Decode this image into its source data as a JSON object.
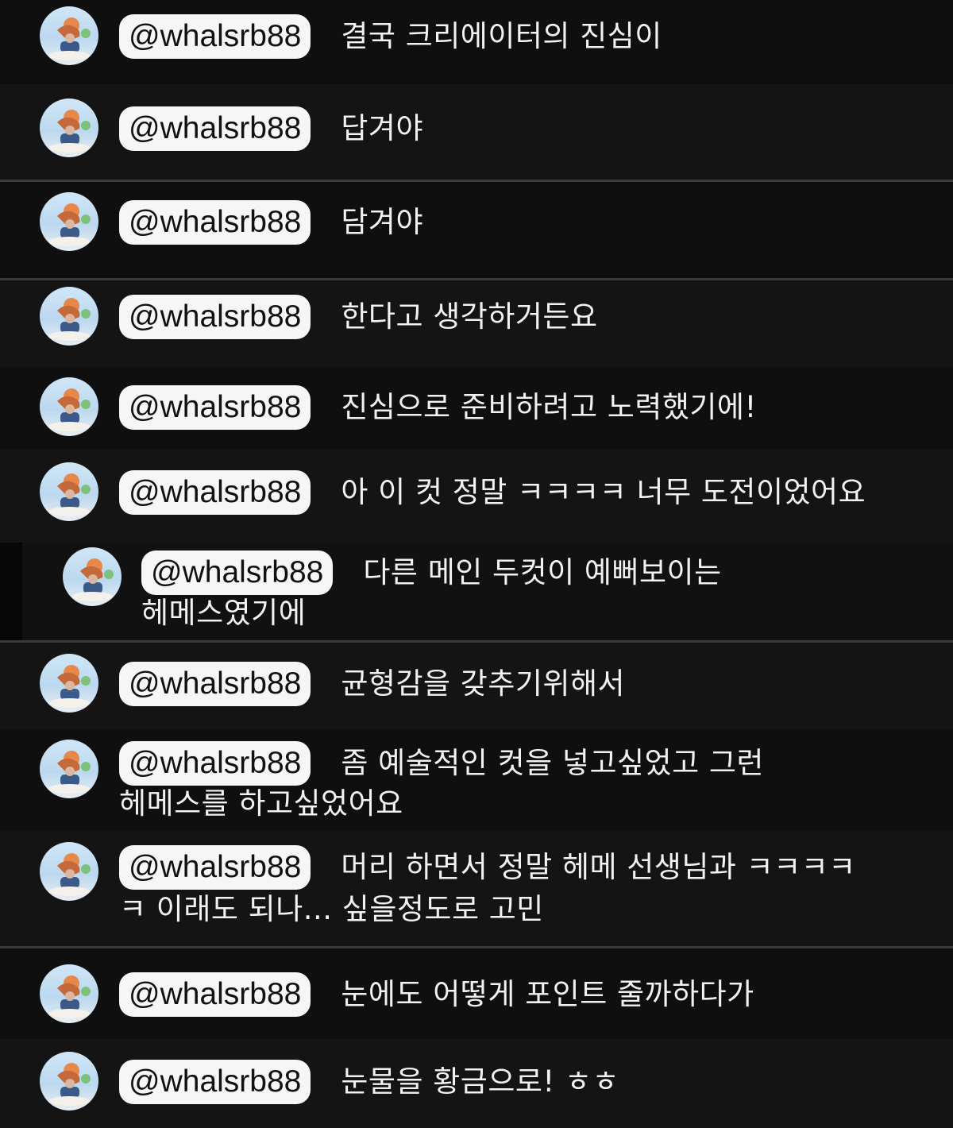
{
  "comments": [
    {
      "username": "@whalsrb88",
      "text": "결국 크리에이터의 진심이"
    },
    {
      "username": "@whalsrb88",
      "text": "답겨야"
    },
    {
      "username": "@whalsrb88",
      "text": "담겨야"
    },
    {
      "username": "@whalsrb88",
      "text": "한다고 생각하거든요"
    },
    {
      "username": "@whalsrb88",
      "text": "진심으로 준비하려고 노력했기에!"
    },
    {
      "username": "@whalsrb88",
      "text": "아 이 컷 정말 ㅋㅋㅋㅋ 너무 도전이었어요"
    },
    {
      "username": "@whalsrb88",
      "text": "다른 메인 두컷이 예뻐보이는",
      "text2": "헤메스였기에"
    },
    {
      "username": "@whalsrb88",
      "text": "균형감을 갖추기위해서"
    },
    {
      "username": "@whalsrb88",
      "text": "좀 예술적인 컷을 넣고싶었고 그런",
      "text2": "헤메스를 하고싶었어요"
    },
    {
      "username": "@whalsrb88",
      "text": "머리 하면서 정말 헤메 선생님과 ㅋㅋㅋㅋ",
      "text2": "ㅋ 이래도 되나... 싶을정도로 고민"
    },
    {
      "username": "@whalsrb88",
      "text": "눈에도 어떻게 포인트 줄까하다가"
    },
    {
      "username": "@whalsrb88",
      "text": "눈물을 황금으로! ㅎㅎ"
    }
  ],
  "avatar_icon": "profile-avatar-icon",
  "colors": {
    "background": "#0c0c0c",
    "badge_bg": "#f6f6f6",
    "badge_text": "#111111",
    "text": "#f2f2f2",
    "divider": "#3a3a3a"
  }
}
